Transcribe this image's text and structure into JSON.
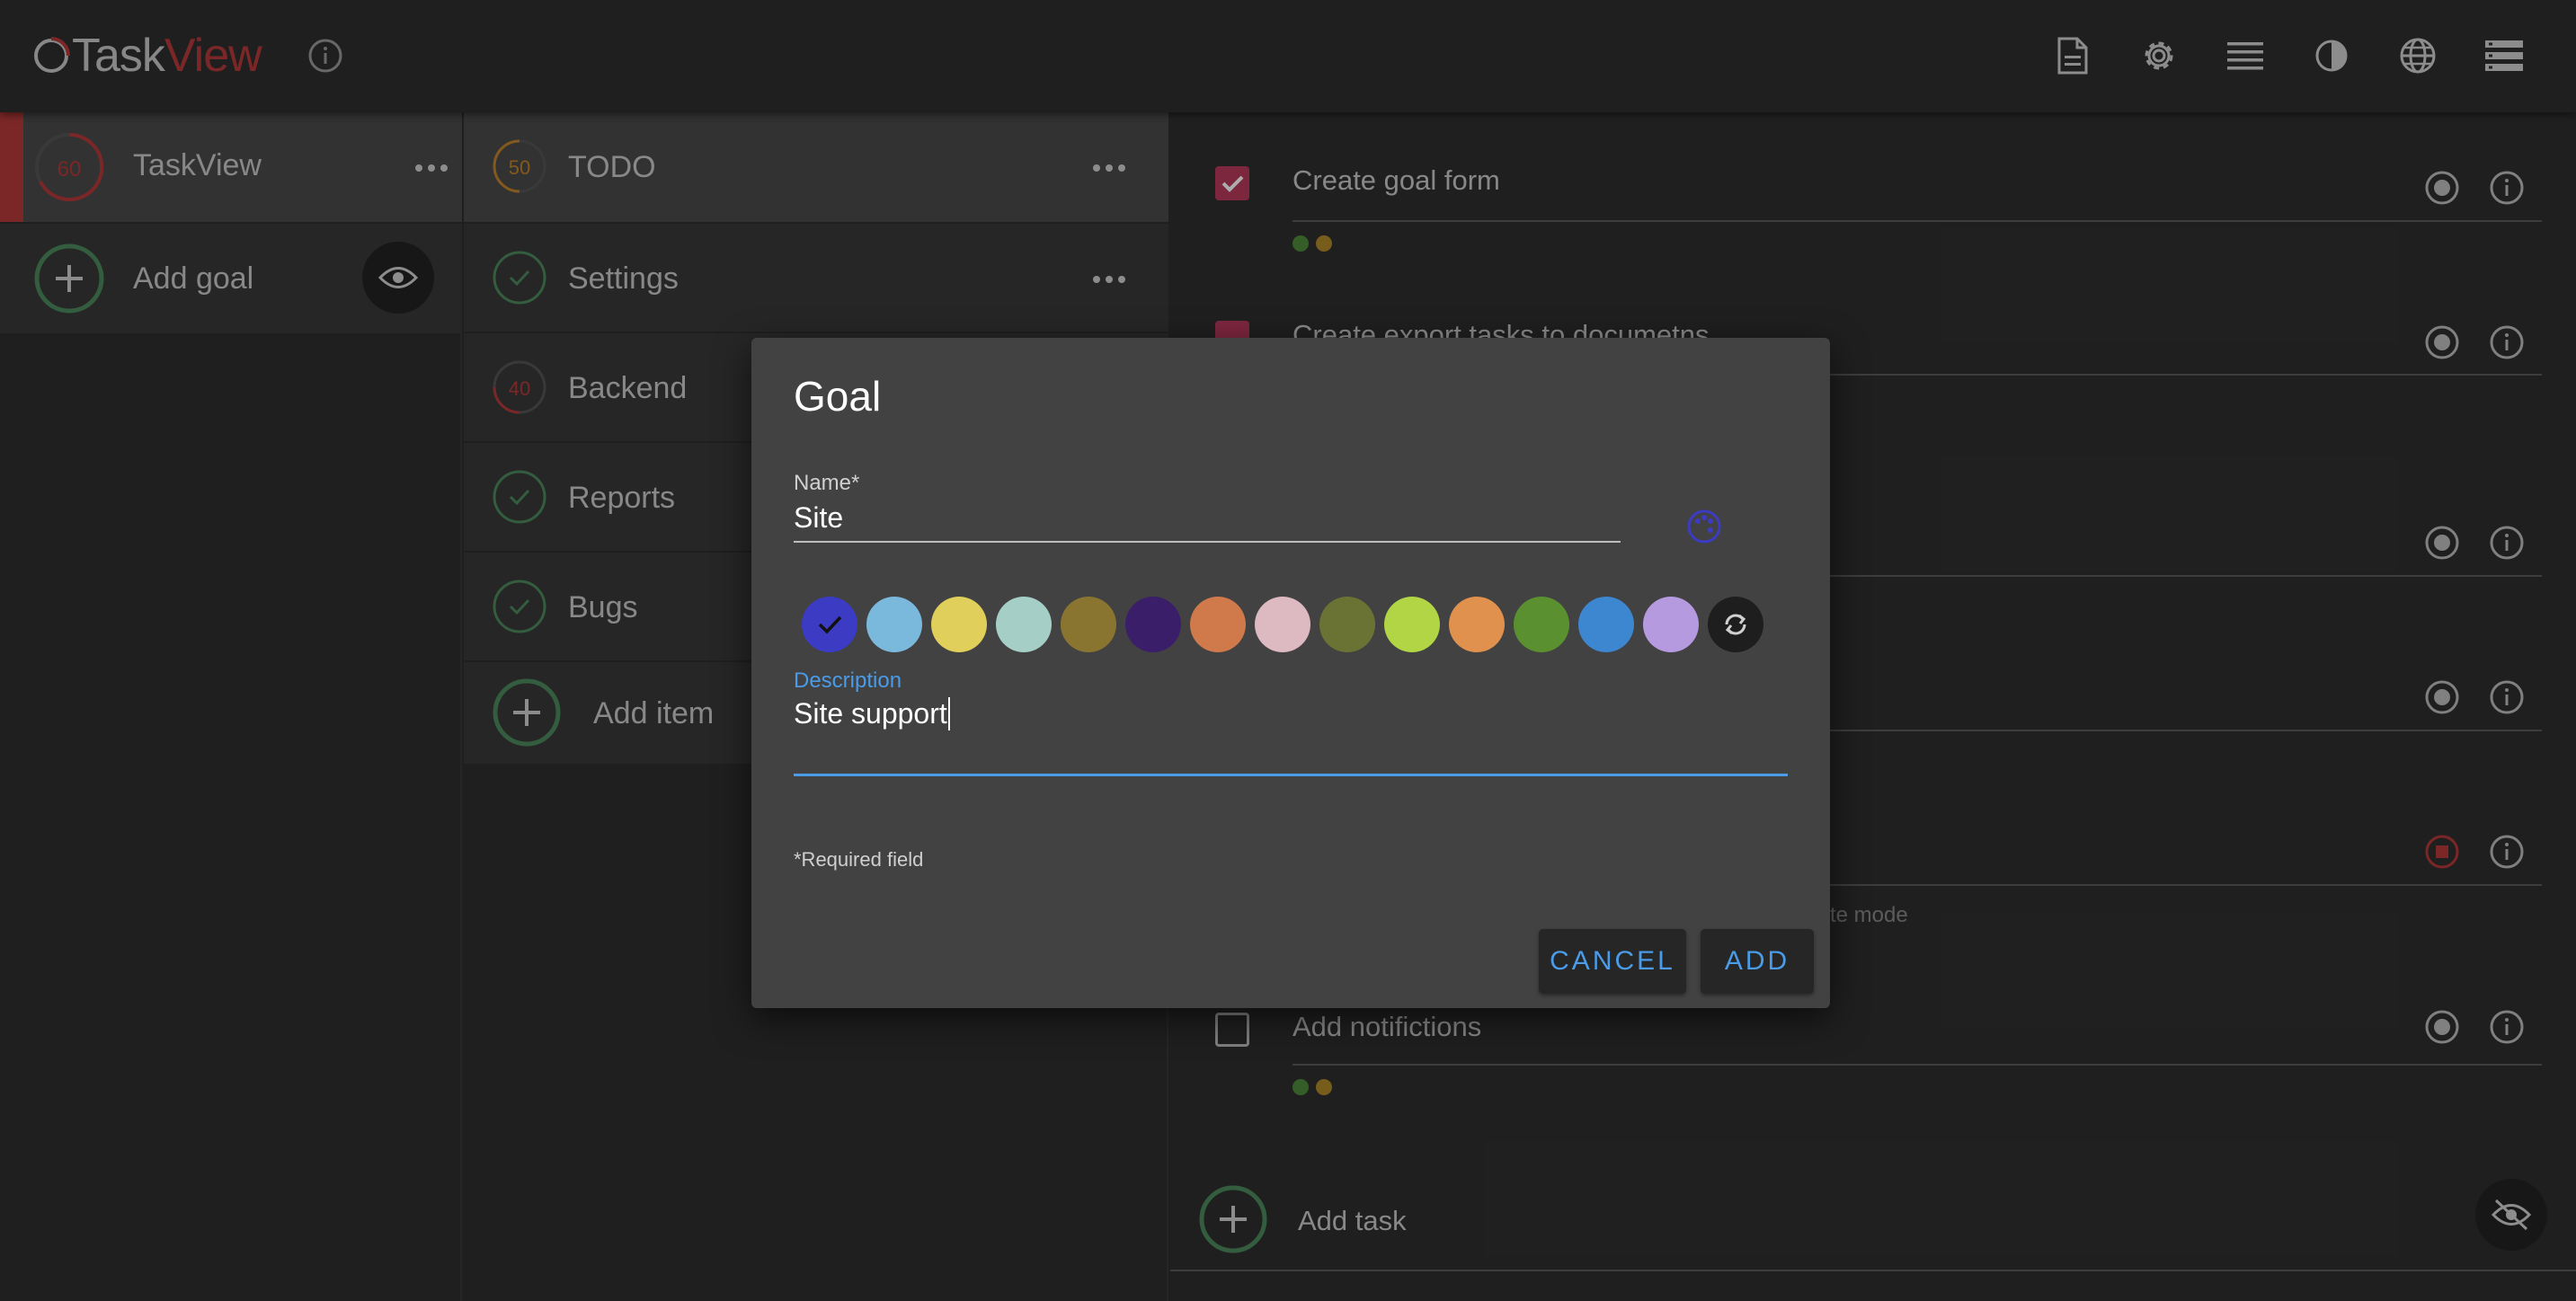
{
  "app": {
    "title_part1": "Task",
    "title_part2": "View"
  },
  "header": {
    "icons": [
      "document-icon",
      "gear-icon",
      "list-icon",
      "contrast-icon",
      "globe-icon",
      "server-icon"
    ]
  },
  "goals": {
    "items": [
      {
        "label": "TaskView",
        "progress": "60",
        "selected": true
      }
    ],
    "add_label": "Add goal"
  },
  "items": {
    "list": [
      {
        "label": "TODO",
        "progress": "50",
        "selected": true
      },
      {
        "label": "Settings",
        "done": true
      },
      {
        "label": "Backend",
        "progress": "40"
      },
      {
        "label": "Reports",
        "done": true
      },
      {
        "label": "Bugs",
        "done": true
      }
    ],
    "add_label": "Add item"
  },
  "tasks": {
    "list": [
      {
        "label": "Create goal form",
        "checked": true
      },
      {
        "label": "Create export tasks to documetns",
        "checked": true
      },
      {
        "label": "Add notifictions",
        "checked": false
      }
    ],
    "hint_fragment": "te mode",
    "add_label": "Add task"
  },
  "dialog": {
    "title": "Goal",
    "name_label": "Name*",
    "name_value": "Site",
    "description_label": "Description",
    "description_value": "Site support",
    "required_note": "*Required field",
    "cancel_label": "CANCEL",
    "add_label": "ADD",
    "colors": [
      "#3b3bc4",
      "#7ab8dc",
      "#e0cf5a",
      "#a5cec6",
      "#8a7530",
      "#3a1e6a",
      "#d07a4c",
      "#ddb9c1",
      "#6a7333",
      "#b1d545",
      "#e0914e",
      "#5b9030",
      "#3d86d0",
      "#b69ae0"
    ],
    "selected_color": "#3b3bc4",
    "accent_color": "#4a9be8"
  }
}
